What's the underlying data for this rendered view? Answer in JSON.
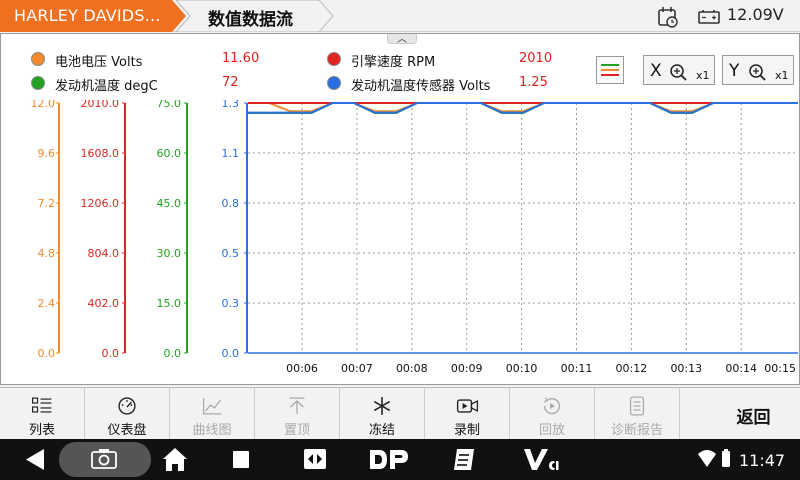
{
  "header": {
    "brand": "HARLEY DAVIDS...",
    "title": "数值数据流",
    "voltage": "12.09V",
    "calendar_icon": "calendar-clock-icon",
    "battery_icon": "battery-icon"
  },
  "legend": [
    {
      "name": "电池电压",
      "unit": "Volts",
      "value": "11.60",
      "color": "#f08a2a"
    },
    {
      "name": "引擎速度",
      "unit": "RPM",
      "value": "2010",
      "color": "#e02424"
    },
    {
      "name": "发动机温度",
      "unit": "degC",
      "value": "72",
      "color": "#22a122"
    },
    {
      "name": "发动机温度传感器",
      "unit": "Volts",
      "value": "1.25",
      "color": "#2a6fe0"
    }
  ],
  "legend_labels": [
    "电池电压  Volts",
    "引擎速度  RPM",
    "发动机温度  degC",
    "发动机温度传感器  Volts"
  ],
  "zoom": {
    "x_label": "X",
    "y_label": "Y",
    "x_level": "x1",
    "y_level": "x1"
  },
  "chart_data": {
    "type": "line",
    "x_ticks": [
      "00:06",
      "00:07",
      "00:08",
      "00:09",
      "00:10",
      "00:11",
      "00:12",
      "00:13",
      "00:14",
      "00:15"
    ],
    "axes": [
      {
        "series": "电池电压",
        "color": "#f08a2a",
        "ticks": [
          "12.0",
          "9.6",
          "7.2",
          "4.8",
          "2.4",
          "0.0"
        ],
        "ylim": [
          0,
          12.0
        ]
      },
      {
        "series": "引擎速度",
        "color": "#e02424",
        "ticks": [
          "2010.0",
          "1608.0",
          "1206.0",
          "804.0",
          "402.0",
          "0.0"
        ],
        "ylim": [
          0,
          2010
        ]
      },
      {
        "series": "发动机温度",
        "color": "#22a122",
        "ticks": [
          "75.0",
          "60.0",
          "45.0",
          "30.0",
          "15.0",
          "0.0"
        ],
        "ylim": [
          0,
          75
        ]
      },
      {
        "series": "发动机温度传感器",
        "color": "#2a6fe0",
        "ticks": [
          "1.3",
          "1.1",
          "0.8",
          "0.5",
          "0.3",
          "0.0"
        ],
        "ylim": [
          0,
          1.3
        ]
      }
    ],
    "series": [
      {
        "name": "电池电压",
        "values": [
          12.0,
          12.0,
          11.6,
          11.6,
          12.0,
          12.0,
          11.6,
          11.6,
          12.0,
          12.0,
          12.0,
          12.0,
          11.6,
          11.6,
          12.0,
          12.0,
          12.0,
          12.0,
          12.0,
          12.0,
          11.6,
          11.6,
          12.0,
          12.0,
          12.0,
          12.0,
          12.0
        ]
      },
      {
        "name": "引擎速度",
        "values": [
          2010,
          2010,
          2010,
          2010,
          2010,
          2010,
          2010,
          2010,
          2010,
          2010,
          2010,
          2010,
          2010,
          2010,
          2010,
          2010,
          2010,
          2010,
          2010,
          2010,
          2010,
          2010,
          2010,
          2010,
          2010,
          2010,
          2010
        ]
      },
      {
        "name": "发动机温度",
        "values": [
          72,
          72,
          72,
          72,
          75,
          75,
          72,
          72,
          75,
          75,
          75,
          75,
          72,
          72,
          75,
          75,
          75,
          75,
          75,
          75,
          72,
          72,
          75,
          75,
          75,
          75,
          75
        ]
      },
      {
        "name": "发动机温度传感器",
        "values": [
          1.25,
          1.25,
          1.25,
          1.25,
          1.3,
          1.3,
          1.25,
          1.25,
          1.3,
          1.3,
          1.3,
          1.3,
          1.25,
          1.25,
          1.3,
          1.3,
          1.3,
          1.3,
          1.3,
          1.3,
          1.25,
          1.25,
          1.3,
          1.3,
          1.3,
          1.3,
          1.3
        ]
      }
    ],
    "grid": true
  },
  "toolbar": {
    "items": [
      {
        "label": "列表",
        "icon": "list-icon",
        "enabled": true
      },
      {
        "label": "仪表盘",
        "icon": "gauge-icon",
        "enabled": true
      },
      {
        "label": "曲线图",
        "icon": "line-chart-icon",
        "enabled": false
      },
      {
        "label": "置顶",
        "icon": "pin-top-icon",
        "enabled": false
      },
      {
        "label": "冻结",
        "icon": "snowflake-icon",
        "enabled": true
      },
      {
        "label": "录制",
        "icon": "record-icon",
        "enabled": true
      },
      {
        "label": "回放",
        "icon": "playback-icon",
        "enabled": false
      },
      {
        "label": "诊断报告",
        "icon": "report-icon",
        "enabled": false
      }
    ],
    "back_label": "返回"
  },
  "navbar": {
    "time": "11:47",
    "icons": [
      "back-icon",
      "screenshot-icon",
      "home-icon",
      "recents-icon",
      "remote-icon",
      "dp-icon",
      "notes-icon",
      "vci-icon",
      "wifi-icon",
      "battery-status-icon"
    ]
  }
}
